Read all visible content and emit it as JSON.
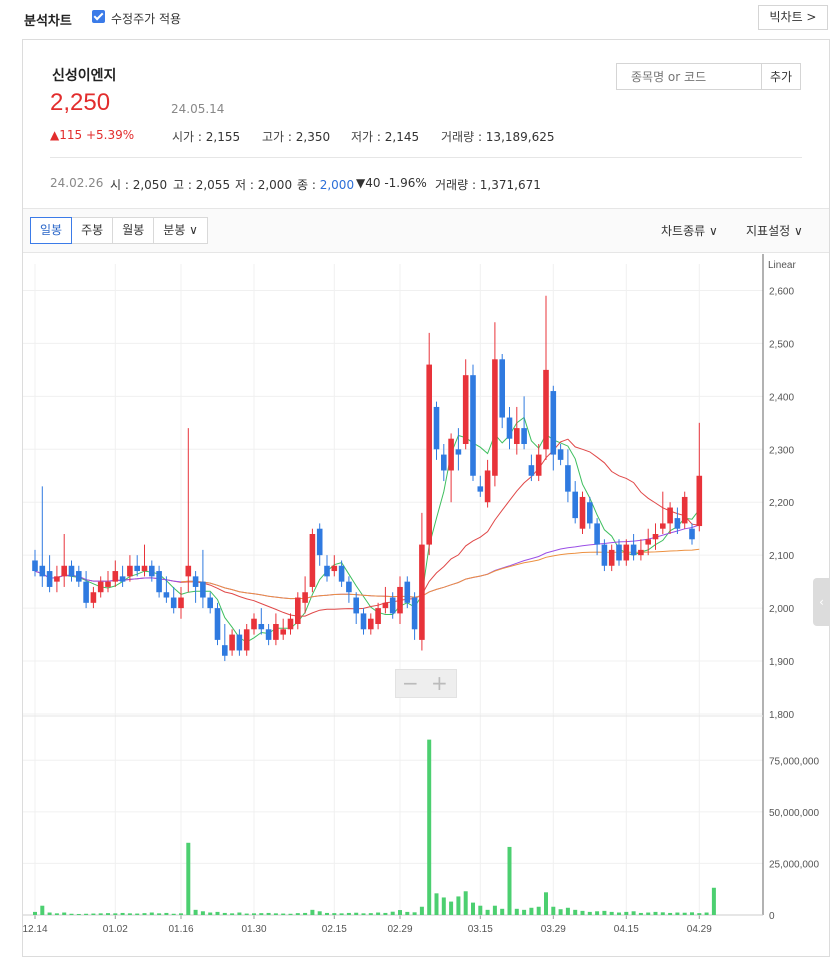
{
  "header": {
    "title": "분석차트",
    "adjusted_label": "수정주가 적용",
    "big_chart_button": "빅차트 >"
  },
  "stock": {
    "name": "신성이엔지",
    "price": "2,250",
    "date": "24.05.14",
    "change": "▲115 +5.39%",
    "open_label": "시가",
    "open": "2,155",
    "high_label": "고가",
    "high": "2,350",
    "low_label": "저가",
    "low": "2,145",
    "volume_label": "거래량",
    "volume": "13,189,625"
  },
  "search": {
    "placeholder": "종목명 or 코드",
    "add_button": "추가"
  },
  "hover_info": {
    "date": "24.02.26",
    "o_label": "시",
    "open": "2,050",
    "h_label": "고",
    "high": "2,055",
    "l_label": "저",
    "low": "2,000",
    "c_label": "종",
    "close": "2,000",
    "change": "▼40 -1.96%",
    "volume_label": "거래량",
    "volume": "1,371,671"
  },
  "period_tabs": [
    "일봉",
    "주봉",
    "월봉",
    "분봉 ∨"
  ],
  "toolbar_right": {
    "chart_type": "차트종류 ∨",
    "indicator": "지표설정 ∨"
  },
  "colors": {
    "up": "#e8333a",
    "down": "#2f7ae0",
    "volume": "#4ccf70",
    "ma5": "#3fbf5f",
    "ma20": "#e04848",
    "ma60": "#9a4fe6",
    "ma120": "#ec9040",
    "accent": "#3b7be8"
  },
  "chart_data": {
    "type": "candlestick",
    "scale_label": "Linear",
    "price_ylim": [
      1800,
      2650
    ],
    "price_ticks": [
      "1,800",
      "1,900",
      "2,000",
      "2,100",
      "2,200",
      "2,300",
      "2,400",
      "2,500",
      "2,600"
    ],
    "volume_ticks": [
      "0",
      "25,000,000",
      "50,000,000",
      "75,000,000"
    ],
    "volume_max": 95000000,
    "x_ticks": [
      {
        "label": "12.14",
        "i": 0
      },
      {
        "label": "01.02",
        "i": 11
      },
      {
        "label": "01.16",
        "i": 20
      },
      {
        "label": "01.30",
        "i": 30
      },
      {
        "label": "02.15",
        "i": 41
      },
      {
        "label": "02.29",
        "i": 50
      },
      {
        "label": "03.15",
        "i": 61
      },
      {
        "label": "03.29",
        "i": 71
      },
      {
        "label": "04.15",
        "i": 81
      },
      {
        "label": "04.29",
        "i": 91
      }
    ],
    "candles_ohlc": [
      [
        2090,
        2110,
        2060,
        2070
      ],
      [
        2080,
        2230,
        2040,
        2060
      ],
      [
        2070,
        2100,
        2030,
        2040
      ],
      [
        2050,
        2080,
        2030,
        2060
      ],
      [
        2060,
        2140,
        2040,
        2080
      ],
      [
        2080,
        2090,
        2050,
        2060
      ],
      [
        2070,
        2080,
        2040,
        2050
      ],
      [
        2050,
        2070,
        2000,
        2010
      ],
      [
        2010,
        2040,
        2000,
        2030
      ],
      [
        2030,
        2060,
        2020,
        2050
      ],
      [
        2040,
        2070,
        2030,
        2050
      ],
      [
        2050,
        2090,
        2040,
        2070
      ],
      [
        2060,
        2080,
        2040,
        2050
      ],
      [
        2060,
        2100,
        2050,
        2080
      ],
      [
        2080,
        2100,
        2060,
        2070
      ],
      [
        2070,
        2120,
        2060,
        2080
      ],
      [
        2080,
        2090,
        2050,
        2060
      ],
      [
        2070,
        2080,
        2020,
        2030
      ],
      [
        2030,
        2060,
        2010,
        2020
      ],
      [
        2020,
        2040,
        1990,
        2000
      ],
      [
        2000,
        2040,
        1980,
        2020
      ],
      [
        2060,
        2340,
        2030,
        2080
      ],
      [
        2060,
        2070,
        2010,
        2040
      ],
      [
        2050,
        2110,
        2000,
        2020
      ],
      [
        2020,
        2030,
        1990,
        2000
      ],
      [
        2000,
        2010,
        1930,
        1940
      ],
      [
        1930,
        1970,
        1900,
        1910
      ],
      [
        1920,
        1960,
        1910,
        1950
      ],
      [
        1950,
        1960,
        1910,
        1920
      ],
      [
        1920,
        1970,
        1910,
        1960
      ],
      [
        1960,
        1990,
        1950,
        1980
      ],
      [
        1970,
        2000,
        1950,
        1960
      ],
      [
        1960,
        1970,
        1930,
        1940
      ],
      [
        1940,
        1990,
        1930,
        1970
      ],
      [
        1950,
        1980,
        1940,
        1960
      ],
      [
        1960,
        1990,
        1950,
        1980
      ],
      [
        1970,
        2030,
        1960,
        2020
      ],
      [
        2010,
        2060,
        1990,
        2030
      ],
      [
        2040,
        2150,
        2030,
        2140
      ],
      [
        2150,
        2160,
        2080,
        2100
      ],
      [
        2080,
        2100,
        2050,
        2060
      ],
      [
        2070,
        2100,
        2060,
        2080
      ],
      [
        2080,
        2090,
        2040,
        2050
      ],
      [
        2050,
        2060,
        2010,
        2030
      ],
      [
        2020,
        2030,
        1970,
        1990
      ],
      [
        1990,
        2000,
        1950,
        1960
      ],
      [
        1960,
        1990,
        1950,
        1980
      ],
      [
        1970,
        2010,
        1960,
        2000
      ],
      [
        2000,
        2040,
        1990,
        2010
      ],
      [
        2020,
        2030,
        1980,
        1990
      ],
      [
        1990,
        2060,
        1970,
        2040
      ],
      [
        2050,
        2060,
        2000,
        2010
      ],
      [
        2020,
        2030,
        1940,
        1960
      ],
      [
        1940,
        2180,
        1920,
        2120
      ],
      [
        2120,
        2520,
        2100,
        2460
      ],
      [
        2380,
        2390,
        2280,
        2300
      ],
      [
        2290,
        2310,
        2240,
        2260
      ],
      [
        2260,
        2330,
        2200,
        2320
      ],
      [
        2300,
        2340,
        2260,
        2290
      ],
      [
        2310,
        2470,
        2300,
        2440
      ],
      [
        2440,
        2460,
        2240,
        2250
      ],
      [
        2230,
        2250,
        2210,
        2220
      ],
      [
        2200,
        2280,
        2190,
        2260
      ],
      [
        2250,
        2540,
        2230,
        2470
      ],
      [
        2470,
        2480,
        2340,
        2360
      ],
      [
        2360,
        2380,
        2300,
        2320
      ],
      [
        2310,
        2380,
        2290,
        2340
      ],
      [
        2340,
        2400,
        2300,
        2310
      ],
      [
        2270,
        2290,
        2240,
        2250
      ],
      [
        2250,
        2310,
        2240,
        2290
      ],
      [
        2300,
        2590,
        2280,
        2450
      ],
      [
        2410,
        2420,
        2260,
        2290
      ],
      [
        2300,
        2310,
        2270,
        2280
      ],
      [
        2270,
        2300,
        2200,
        2220
      ],
      [
        2220,
        2240,
        2160,
        2170
      ],
      [
        2150,
        2220,
        2140,
        2210
      ],
      [
        2200,
        2210,
        2150,
        2160
      ],
      [
        2160,
        2170,
        2100,
        2120
      ],
      [
        2120,
        2130,
        2070,
        2080
      ],
      [
        2080,
        2120,
        2070,
        2110
      ],
      [
        2120,
        2130,
        2080,
        2090
      ],
      [
        2090,
        2130,
        2080,
        2120
      ],
      [
        2120,
        2140,
        2090,
        2100
      ],
      [
        2100,
        2130,
        2090,
        2110
      ],
      [
        2120,
        2150,
        2100,
        2130
      ],
      [
        2130,
        2160,
        2110,
        2140
      ],
      [
        2150,
        2220,
        2140,
        2160
      ],
      [
        2160,
        2200,
        2140,
        2190
      ],
      [
        2170,
        2190,
        2140,
        2150
      ],
      [
        2160,
        2220,
        2150,
        2210
      ],
      [
        2150,
        2160,
        2120,
        2130
      ],
      [
        2155,
        2350,
        2145,
        2250
      ]
    ],
    "volumes_m": [
      1.5,
      4.5,
      1.2,
      0.8,
      1.2,
      0.6,
      0.5,
      0.6,
      0.7,
      0.8,
      0.9,
      0.8,
      1,
      0.8,
      0.7,
      0.9,
      1.2,
      0.8,
      1,
      0.6,
      0.8,
      35,
      2.5,
      1.8,
      1.2,
      1.5,
      1,
      0.8,
      1.2,
      0.7,
      0.8,
      0.9,
      1,
      0.8,
      0.7,
      0.6,
      0.9,
      1,
      2.5,
      1.8,
      1,
      0.9,
      0.8,
      1,
      1.1,
      0.8,
      0.9,
      1.2,
      1,
      1.6,
      2.4,
      1.5,
      1.3,
      4,
      85,
      10.5,
      8.5,
      6.5,
      9,
      11.5,
      6,
      4.5,
      2.5,
      4.5,
      3,
      33,
      3,
      2.5,
      3.5,
      4,
      11,
      4,
      2.8,
      3.5,
      2.5,
      2,
      1.5,
      1.8,
      2,
      1.5,
      1.2,
      1.5,
      1.8,
      1,
      1.2,
      1.5,
      1.3,
      1,
      1.2,
      1.1,
      1.3,
      0.9,
      1.2,
      13.2
    ]
  }
}
